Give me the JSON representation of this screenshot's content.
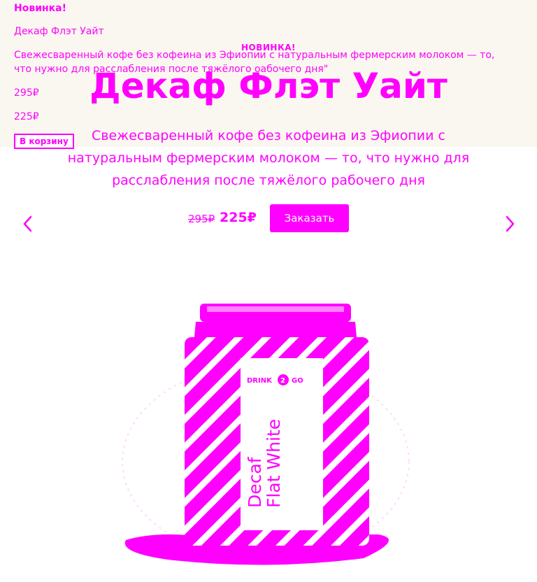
{
  "fallback": {
    "badge": "Новинка!",
    "title": "Декаф Флэт Уайт",
    "description": "Свежесваренный кофе без кофеина из Эфиопии с натуральным фермерским молоком — то, что нужно для расслабления после тяжёлого оабочего дня\"",
    "old_price": "295₽",
    "new_price": "225₽",
    "cart_button": "В корзину"
  },
  "hero": {
    "badge": "НОВИНКА!",
    "title": "Декаф Флэт Уайт",
    "description": "Свежесваренный кофе без кофеина из Эфиопии с натуральным фермерским молоком — то, что нужно для расслабления после тяжёлого рабочего дня",
    "old_price": "295₽",
    "new_price": "225₽",
    "order_button": "Заказать"
  },
  "can": {
    "brand": "DRINK 2 GO",
    "product_line1": "Decaf",
    "product_line2": "Flat White"
  },
  "colors": {
    "accent": "#ff00ff",
    "background": "#ffffff",
    "top_band": "#faf7f0"
  },
  "icons": {
    "prev": "chevron-left-icon",
    "next": "chevron-right-icon"
  }
}
